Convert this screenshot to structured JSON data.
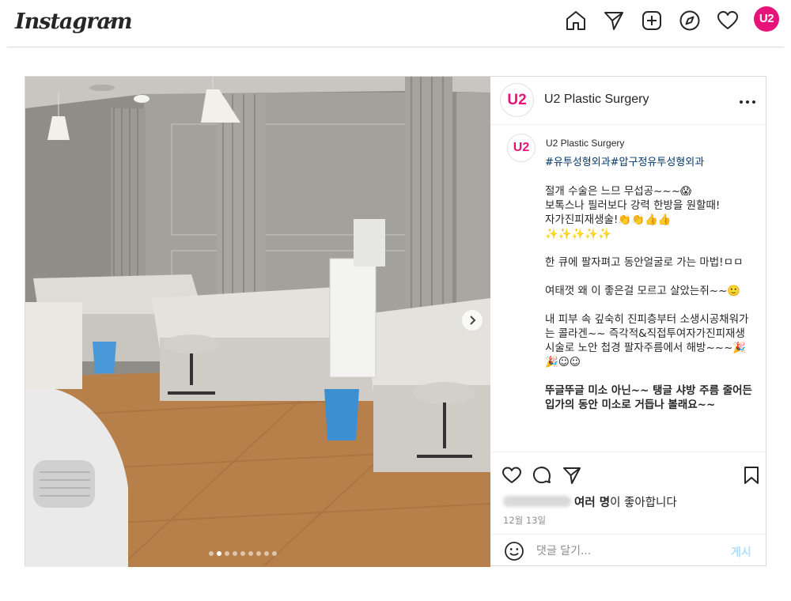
{
  "brand": {
    "logo_text": "Instagram",
    "accent": "#e6147a",
    "link_color": "#00376b"
  },
  "nav": {
    "icons": [
      "home-icon",
      "direct-send-icon",
      "new-post-icon",
      "explore-compass-icon",
      "activity-heart-icon"
    ],
    "profile_avatar": "U2"
  },
  "post": {
    "account": {
      "name": "U2 Plastic Surgery",
      "avatar_text": "U2"
    },
    "carousel": {
      "total_slides": 9,
      "current_slide": 2
    },
    "caption": {
      "username": "U2 Plastic Surgery",
      "hashtags": "#유투성형외과#압구정유투성형외과",
      "paragraphs": [
        "절개 수술은 느므 무섭공~~~😱\n보톡스나 필러보다 강력 한방을 원할때!\n자가진피재생술!👏👏👍👍\n✨✨✨✨✨",
        "한 큐에 팔자펴고 동안얼굴로 가는 마법!ㅁㅁ",
        "여태껏 왜 이 좋은걸 모르고 살았는쥐~~🙂",
        "내 피부 속 깊숙히 진피층부터 소생시공채워가는 콜라겐~~ 즉각적&직접투여자가진피재생시술로 노안 첩경 팔자주름에서 해방~~~🎉🎉☺☺",
        "뚜글뚜글 미소 아닌~~ 탱글 샤방 주름 줄어든 입가의 동안 미소로 거듭나 볼래요~~"
      ]
    },
    "likes": {
      "bold_text": "여러 명",
      "suffix": "이 좋아합니다"
    },
    "date": "12월 13일",
    "comment": {
      "placeholder": "댓글 달기...",
      "post_label": "게시"
    }
  }
}
